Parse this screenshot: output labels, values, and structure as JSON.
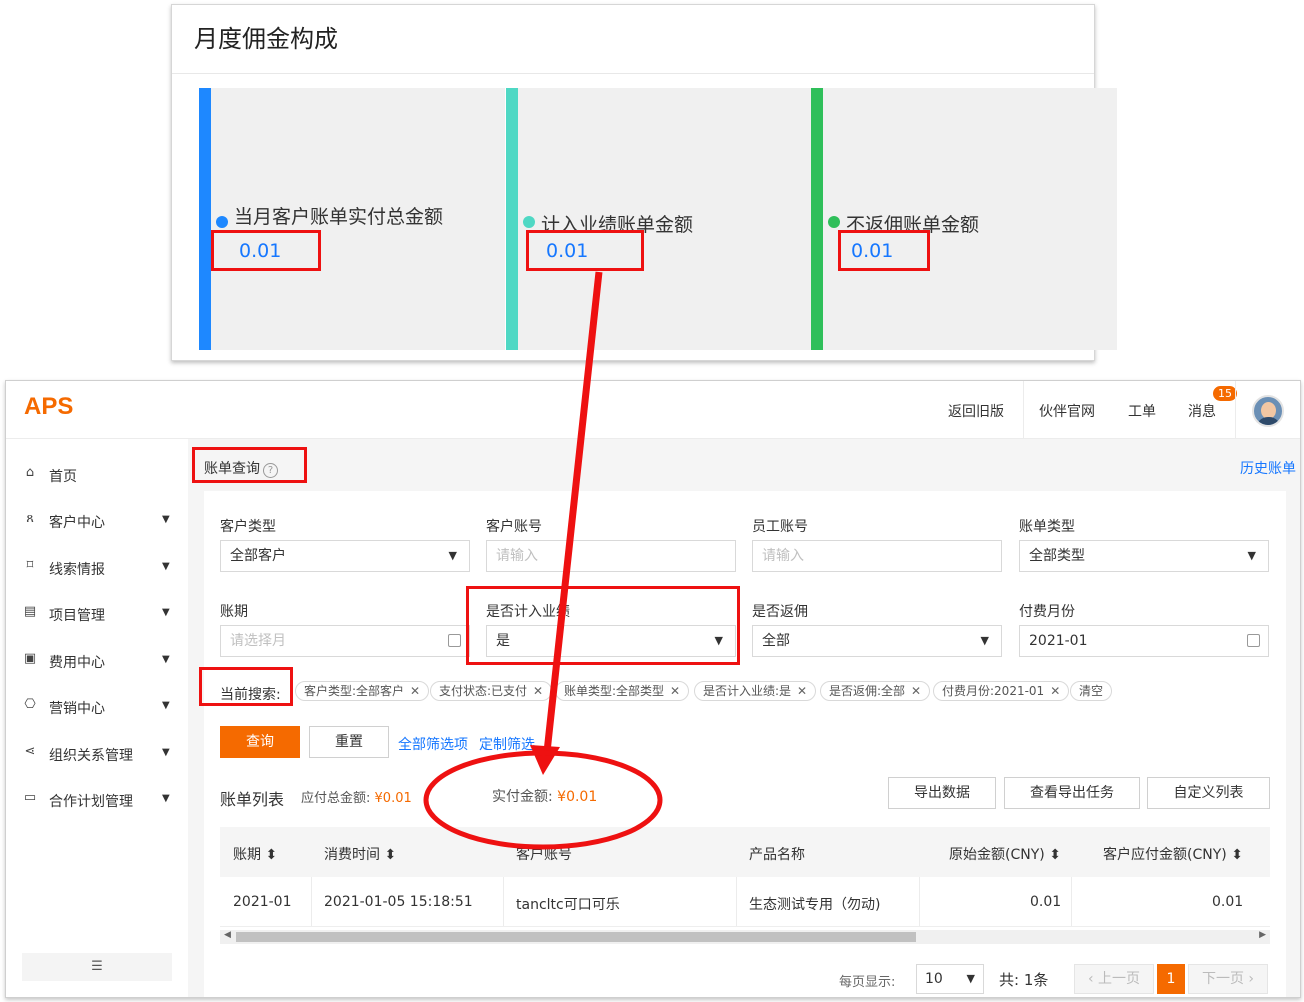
{
  "commission": {
    "title": "月度佣金构成",
    "stats": [
      {
        "label": "当月客户账单实付总金额",
        "value": "0.01",
        "color": "#1e88ff"
      },
      {
        "label": "计入业绩账单金额",
        "value": "0.01",
        "color": "#4fd8c4"
      },
      {
        "label": "不返佣账单金额",
        "value": "0.01",
        "color": "#2fbf5a"
      }
    ]
  },
  "app": {
    "logo": "APS",
    "top_nav": [
      "返回旧版",
      "伙伴官网",
      "工单",
      "消息"
    ],
    "message_badge": "15",
    "sidebar": [
      {
        "label": "首页",
        "icon": "home-icon",
        "glyph": "⌂",
        "caret": false
      },
      {
        "label": "客户中心",
        "icon": "users-icon",
        "glyph": "ጸ",
        "caret": true
      },
      {
        "label": "线索情报",
        "icon": "leads-icon",
        "glyph": "⌑",
        "caret": true
      },
      {
        "label": "项目管理",
        "icon": "project-icon",
        "glyph": "▤",
        "caret": true
      },
      {
        "label": "费用中心",
        "icon": "fee-icon",
        "glyph": "▣",
        "caret": true
      },
      {
        "label": "营销中心",
        "icon": "marketing-icon",
        "glyph": "⎔",
        "caret": true
      },
      {
        "label": "组织关系管理",
        "icon": "share-icon",
        "glyph": "⋖",
        "caret": true
      },
      {
        "label": "合作计划管理",
        "icon": "plan-icon",
        "glyph": "▭",
        "caret": true
      }
    ],
    "collapse_glyph": "☰",
    "breadcrumb": "账单查询",
    "help_glyph": "?",
    "history_link": "历史账单"
  },
  "filters": {
    "customer_type": {
      "label": "客户类型",
      "value": "全部客户"
    },
    "customer_account": {
      "label": "客户账号",
      "placeholder": "请输入"
    },
    "employee_account": {
      "label": "员工账号",
      "placeholder": "请输入"
    },
    "bill_type": {
      "label": "账单类型",
      "value": "全部类型"
    },
    "period": {
      "label": "账期",
      "placeholder": "请选择月"
    },
    "count_performance": {
      "label": "是否计入业绩",
      "value": "是"
    },
    "rebate": {
      "label": "是否返佣",
      "value": "全部"
    },
    "pay_month": {
      "label": "付费月份",
      "value": "2021-01"
    }
  },
  "current_search": {
    "label": "当前搜索:",
    "tags": [
      "客户类型:全部客户",
      "支付状态:已支付",
      "账单类型:全部类型",
      "是否计入业绩:是",
      "是否返佣:全部",
      "付费月份:2021-01"
    ],
    "clear": "清空"
  },
  "actions": {
    "query": "查询",
    "reset": "重置",
    "all_filters": "全部筛选项",
    "custom_filters": "定制筛选"
  },
  "list": {
    "title": "账单列表",
    "total_label": "应付总金额:",
    "total_value": "¥0.01",
    "paid_label": "实付金额:",
    "paid_value": "¥0.01",
    "buttons": [
      "导出数据",
      "查看导出任务",
      "自定义列表"
    ],
    "columns": [
      "账期",
      "消费时间",
      "客户账号",
      "产品名称",
      "原始金额(CNY)",
      "客户应付金额(CNY)"
    ],
    "rows": [
      [
        "2021-01",
        "2021-01-05 15:18:51",
        "tancltc可口可乐",
        "生态测试专用（勿动)",
        "0.01",
        "0.01"
      ]
    ]
  },
  "pagination": {
    "per_page_label": "每页显示:",
    "per_page": "10",
    "total": "共: 1条",
    "prev": "上一页",
    "next": "下一页",
    "current": "1"
  },
  "colors": {
    "accent": "#f56a00",
    "link": "#1677ff",
    "annotation": "#ee1111"
  }
}
